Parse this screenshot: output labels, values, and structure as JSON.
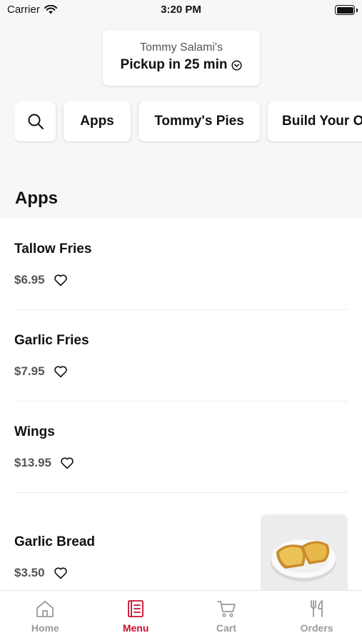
{
  "status_bar": {
    "carrier": "Carrier",
    "time": "3:20 PM"
  },
  "store": {
    "name": "Tommy Salami's",
    "pickup": "Pickup in 25 min"
  },
  "categories": [
    "Apps",
    "Tommy's Pies",
    "Build Your O"
  ],
  "section_title": "Apps",
  "items": [
    {
      "name": "Tallow Fries",
      "price": "$6.95"
    },
    {
      "name": "Garlic Fries",
      "price": "$7.95"
    },
    {
      "name": "Wings",
      "price": "$13.95"
    },
    {
      "name": "Garlic Bread",
      "price": "$3.50"
    }
  ],
  "tabs": [
    {
      "label": "Home",
      "icon": "home-icon"
    },
    {
      "label": "Menu",
      "icon": "menu-icon",
      "active": true
    },
    {
      "label": "Cart",
      "icon": "cart-icon"
    },
    {
      "label": "Orders",
      "icon": "orders-icon"
    }
  ],
  "colors": {
    "accent": "#c8102e",
    "inactive_tab": "#9a9a9a",
    "background": "#f7f7f7"
  }
}
